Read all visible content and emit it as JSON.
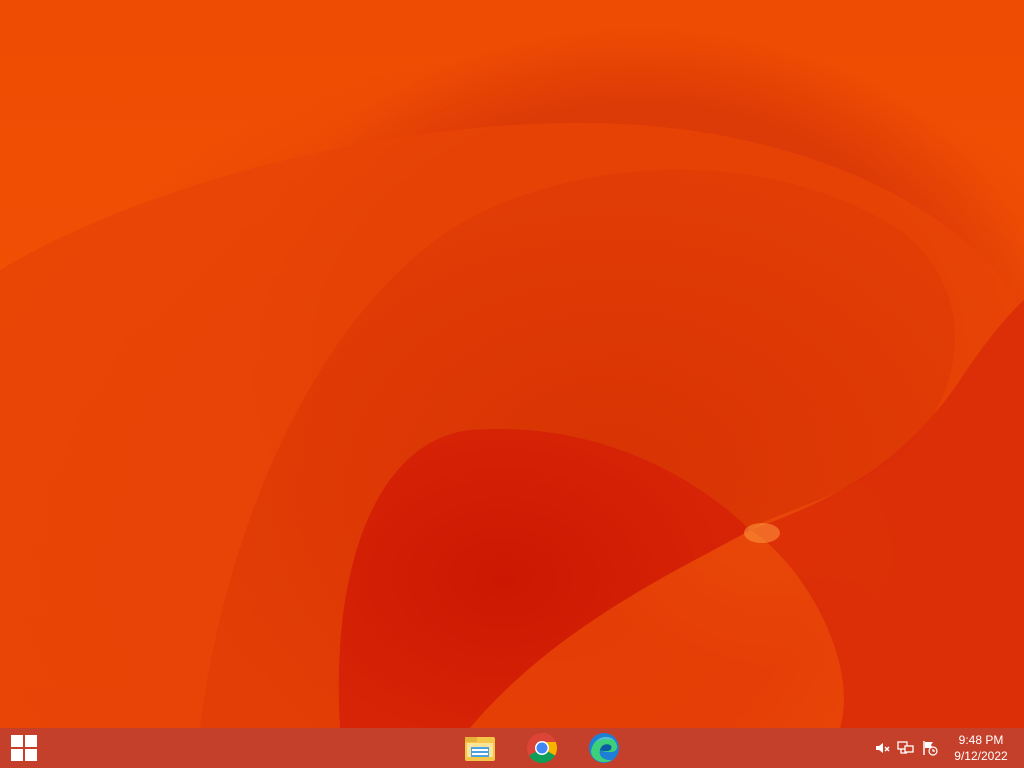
{
  "desktop": {
    "wallpaper_colors": {
      "base": "#ee4c02",
      "mid": "#dc3a06",
      "deep": "#d01a02",
      "glow": "#ff8c28"
    }
  },
  "taskbar": {
    "color": "#c4402a",
    "start_icon": "windows-logo-icon",
    "pinned_apps": [
      {
        "name": "File Explorer",
        "icon": "file-explorer-icon"
      },
      {
        "name": "Google Chrome",
        "icon": "chrome-icon"
      },
      {
        "name": "Microsoft Edge",
        "icon": "edge-icon"
      }
    ],
    "tray": {
      "icons": [
        "volume-muted-icon",
        "network-icon",
        "action-center-flag-icon"
      ],
      "time": "9:48 PM",
      "date": "9/12/2022"
    }
  }
}
